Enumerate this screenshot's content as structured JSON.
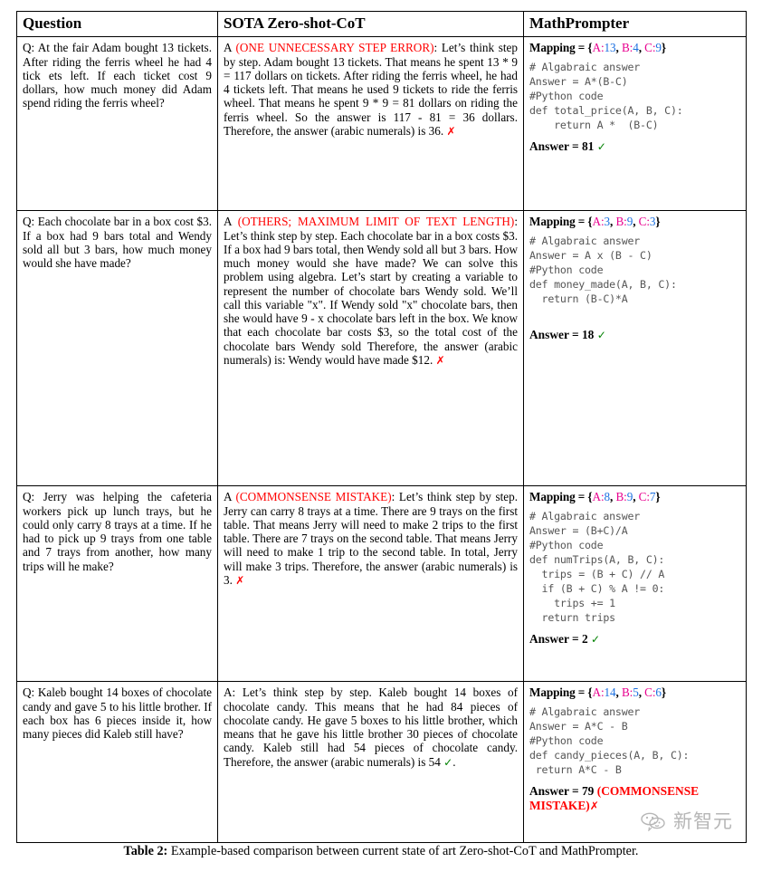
{
  "table": {
    "headers": [
      "Question",
      "SOTA Zero-shot-CoT",
      "MathPrompter"
    ],
    "rows": [
      {
        "question": "Q: At the fair Adam bought 13 tickets. After riding the ferris wheel he had 4 tick­ ets left. If each ticket cost 9 dollars, how much money did Adam spend riding the ferris wheel?",
        "cot": {
          "prefix": "A ",
          "error_label": "(ONE UNNECESSARY STEP ERROR)",
          "body": ": Let’s think step by step. Adam bought 13 tickets. That means he spent 13 * 9 = 117 dollars on tickets. After riding the ferris wheel, he had 4 tickets left. That means he used 9 tickets to ride the ferris wheel. That means he spent 9 * 9 = 81 dollars on riding the ferris wheel. So the answer is 117 - 81 = 36 dollars. Therefore, the answer (arabic numerals) is 36. ",
          "mark": "✗",
          "mark_kind": "wrong"
        },
        "mp": {
          "mapping_label": "Mapping = ",
          "mapping_open": "{",
          "vars": [
            {
              "name": "A",
              "sep": ":",
              "value": "13",
              "tail": ", "
            },
            {
              "name": "B",
              "sep": ":",
              "value": "4",
              "tail": ", "
            },
            {
              "name": "C",
              "sep": ":",
              "value": "9",
              "tail": ""
            }
          ],
          "mapping_close": "}",
          "code": "# Algabraic answer\nAnswer = A*(B-C)\n#Python code\ndef total_price(A, B, C):\n    return A *  (B-C)",
          "answer_prefix": "Answer = ",
          "answer_value": "81",
          "answer_note": "",
          "mark": "✓",
          "mark_kind": "right"
        }
      },
      {
        "question": "Q: Each chocolate bar in a box cost $3. If a box had 9 bars total and Wendy sold all but 3 bars, how much money would she have made?",
        "cot": {
          "prefix": "A ",
          "error_label": "(OTHERS; MAXIMUM LIMIT OF TEXT LENGTH)",
          "body": ": Let’s think step by step. Each chocolate bar in a box costs $3. If a box had 9 bars total, then Wendy sold all but 3 bars. How much money would she have made? We can solve this problem using algebra. Let’s start by creating a variable to represent the number of chocolate bars Wendy sold. We’ll call this variable \"x\". If Wendy sold \"x\" chocolate bars, then she would have 9 - x chocolate bars left in the box. We know that each chocolate bar costs $3, so the total cost of the chocolate bars Wendy sold Therefore, the answer (arabic numerals) is: Wendy would have made $12. ",
          "mark": "✗",
          "mark_kind": "wrong"
        },
        "mp": {
          "mapping_label": "Mapping = ",
          "mapping_open": "{",
          "vars": [
            {
              "name": "A",
              "sep": ":",
              "value": "3",
              "tail": ", "
            },
            {
              "name": "B",
              "sep": ":",
              "value": "9",
              "tail": ", "
            },
            {
              "name": "C",
              "sep": ":",
              "value": "3",
              "tail": ""
            }
          ],
          "mapping_close": "}",
          "code": "# Algabraic answer\nAnswer = A x (B - C)\n#Python code\ndef money_made(A, B, C):\n  return (B-C)*A",
          "answer_prefix": "Answer = ",
          "answer_value": "18",
          "answer_note": "",
          "mark": "✓",
          "mark_kind": "right"
        }
      },
      {
        "question": "Q: Jerry was helping the cafeteria workers pick up lunch trays, but he could only carry 8 trays at a time. If he had to pick up 9 trays from one table and 7 trays from another, how many trips will he make?",
        "cot": {
          "prefix": "A ",
          "error_label": "(COMMONSENSE MISTAKE)",
          "body": ": Let’s think step by step. Jerry can carry 8 trays at a time. There are 9 trays on the first table. That means Jerry will need to make 2 trips to the first table. There are 7 trays on the second table. That means Jerry will need to make 1 trip to the second table. In total, Jerry will make 3 trips. Therefore, the answer (arabic numerals) is 3. ",
          "mark": "✗",
          "mark_kind": "wrong"
        },
        "mp": {
          "mapping_label": "Mapping = ",
          "mapping_open": "{",
          "vars": [
            {
              "name": "A",
              "sep": ":",
              "value": "8",
              "tail": ", "
            },
            {
              "name": "B",
              "sep": ":",
              "value": "9",
              "tail": ", "
            },
            {
              "name": "C",
              "sep": ":",
              "value": "7",
              "tail": ""
            }
          ],
          "mapping_close": "}",
          "code": "# Algabraic answer\nAnswer = (B+C)/A\n#Python code\ndef numTrips(A, B, C):\n  trips = (B + C) // A\n  if (B + C) % A != 0:\n    trips += 1\n  return trips",
          "answer_prefix": "Answer = ",
          "answer_value": "2",
          "answer_note": "",
          "mark": "✓",
          "mark_kind": "right"
        }
      },
      {
        "question": "Q: Kaleb bought 14 boxes of chocolate candy and gave 5 to his little brother. If each box has 6 pieces inside it, how many pieces did Kaleb still have?",
        "cot": {
          "prefix": "A",
          "error_label": "",
          "body": ": Let’s think step by step. Kaleb bought 14 boxes of chocolate candy. This means that he had 84 pieces of chocolate candy. He gave 5 boxes to his little brother, which means that he gave his little brother 30 pieces of chocolate candy. Kaleb still had 54 pieces of chocolate candy. Therefore, the answer (arabic numerals) is 54 ",
          "mark": "✓",
          "mark_kind": "right",
          "suffix": "."
        },
        "mp": {
          "mapping_label": "Mapping = ",
          "mapping_open": "{",
          "vars": [
            {
              "name": "A",
              "sep": ":",
              "value": "14",
              "tail": ", "
            },
            {
              "name": "B",
              "sep": ":",
              "value": "5",
              "tail": ", "
            },
            {
              "name": "C",
              "sep": ":",
              "value": "6",
              "tail": ""
            }
          ],
          "mapping_close": "}",
          "code": "# Algabraic answer\nAnswer = A*C - B\n#Python code\ndef candy_pieces(A, B, C):\n return A*C - B",
          "answer_prefix": "Answer = ",
          "answer_value": "79",
          "answer_note": "(COMMONSENSE MISTAKE)",
          "mark": "✗",
          "mark_kind": "wrong"
        }
      }
    ]
  },
  "caption": {
    "label": "Table 2:",
    "text": "Example-based comparison between current state of art Zero-shot-CoT and MathPrompter."
  },
  "watermark": {
    "text": "新智元",
    "icon": "speech-bubble-icon"
  },
  "colors": {
    "error_red": "#ff0000",
    "check_green": "#008000",
    "var_magenta": "#e8008f",
    "value_blue": "#1b6fe0",
    "code_gray": "#555555"
  }
}
